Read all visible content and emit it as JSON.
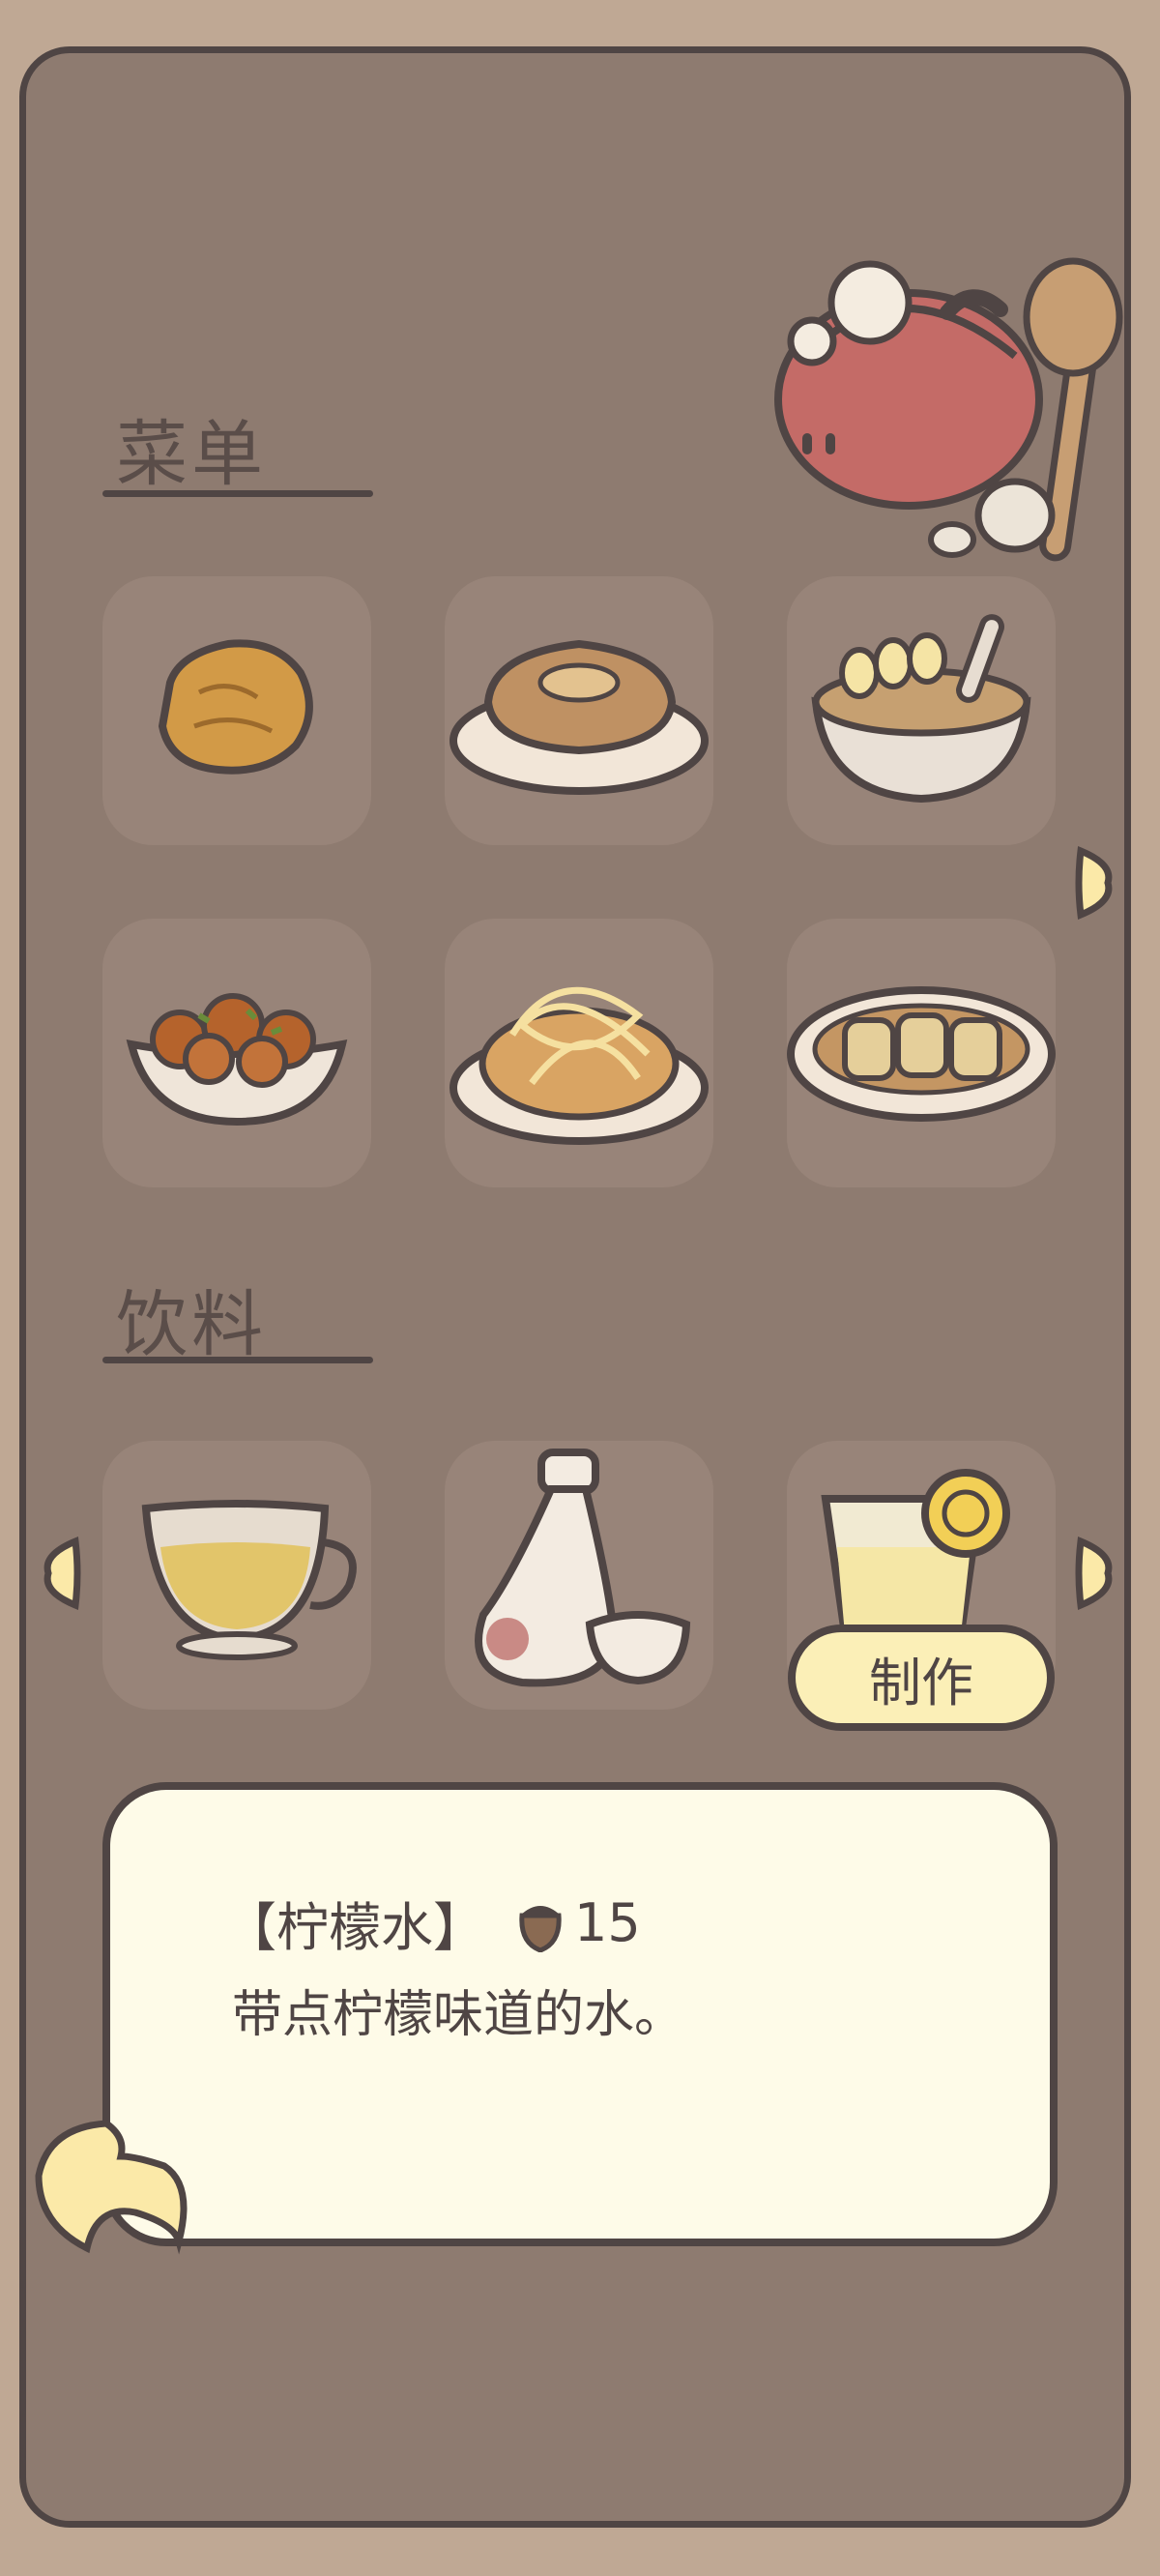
{
  "sections": {
    "menu_title": "菜单",
    "drinks_title": "饮料"
  },
  "menu_items": [
    {
      "icon": "hash-brown-icon"
    },
    {
      "icon": "pancake-plate-icon"
    },
    {
      "icon": "banana-pudding-bowl-icon"
    },
    {
      "icon": "takoyaki-bowl-icon"
    },
    {
      "icon": "noodles-plate-icon"
    },
    {
      "icon": "rolled-omelette-plate-icon"
    }
  ],
  "drink_items": [
    {
      "icon": "tea-cup-icon"
    },
    {
      "icon": "sake-bottle-icon"
    },
    {
      "icon": "lemon-water-glass-icon",
      "selected": true
    }
  ],
  "make_button": {
    "label": "制作"
  },
  "detail": {
    "name": "【柠檬水】",
    "price": "15",
    "price_icon": "acorn-icon",
    "description": "带点柠檬味道的水。"
  },
  "colors": {
    "background": "#bfa894",
    "panel": "#8e7b70",
    "tile": "#988479",
    "outline": "#4f4544",
    "button": "#fbefb7",
    "card": "#fefbe8",
    "arrow": "#fbe9a8"
  }
}
